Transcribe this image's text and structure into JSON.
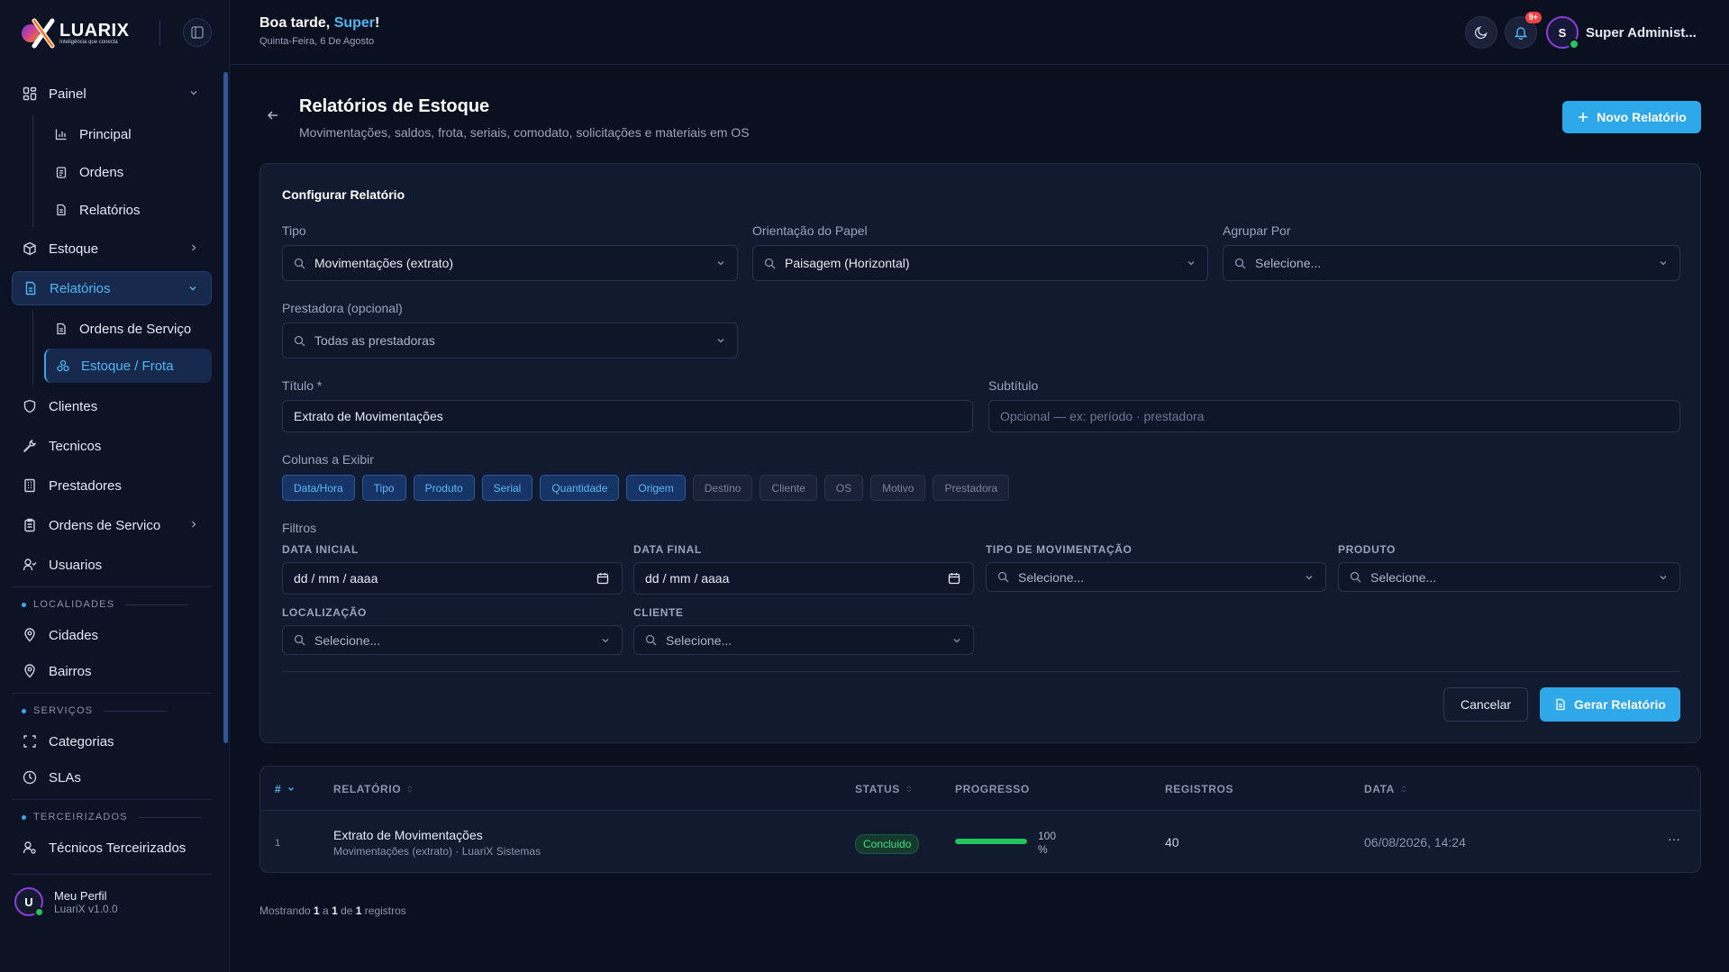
{
  "brand": {
    "name": "LUARIX",
    "tagline": "Inteligência que conecta"
  },
  "sidebar": {
    "painel": {
      "label": "Painel",
      "sub": [
        "Principal",
        "Ordens",
        "Relatórios"
      ]
    },
    "estoque": "Estoque",
    "relatorios": {
      "label": "Relatórios",
      "sub": [
        "Ordens de Serviço",
        "Estoque / Frota"
      ]
    },
    "clientes": "Clientes",
    "tecnicos": "Tecnicos",
    "prestadores": "Prestadores",
    "ordens_servico": "Ordens de Servico",
    "usuarios": "Usuarios",
    "sec_localidades": "LOCALIDADES",
    "cidades": "Cidades",
    "bairros": "Bairros",
    "sec_servicos": "SERVIÇOS",
    "categorias": "Categorias",
    "slas": "SLAs",
    "sec_terceirizados": "TERCEIRIZADOS",
    "tecnicos_terceirizados": "Técnicos Terceirizados",
    "profile": {
      "initial": "U",
      "name": "Meu Perfil",
      "version": "LuariX v1.0.0"
    }
  },
  "header": {
    "greet_prefix": "Boa tarde, ",
    "greet_name": "Super",
    "greet_suffix": "!",
    "date": "Quinta-Feira, 6 De Agosto",
    "notif_badge": "9+",
    "user_initial": "S",
    "user_name": "Super Administ..."
  },
  "page": {
    "title": "Relatórios de Estoque",
    "subtitle": "Movimentações, saldos, frota, seriais, comodato, solicitações e materiais em OS",
    "new_button": "Novo Relatório"
  },
  "config": {
    "title": "Configurar Relatório",
    "tipo": {
      "label": "Tipo",
      "value": "Movimentações (extrato)"
    },
    "orientacao": {
      "label": "Orientação do Papel",
      "value": "Paisagem (Horizontal)"
    },
    "agrupar": {
      "label": "Agrupar Por",
      "placeholder": "Selecione..."
    },
    "prestadora": {
      "label": "Prestadora (opcional)",
      "value": "Todas as prestadoras"
    },
    "titulo": {
      "label": "Título *",
      "value": "Extrato de Movimentações"
    },
    "subtitulo": {
      "label": "Subtítulo",
      "placeholder": "Opcional — ex: período · prestadora"
    },
    "colunas_label": "Colunas a Exibir",
    "colunas": [
      {
        "label": "Data/Hora",
        "on": true
      },
      {
        "label": "Tipo",
        "on": true
      },
      {
        "label": "Produto",
        "on": true
      },
      {
        "label": "Serial",
        "on": true
      },
      {
        "label": "Quantidade",
        "on": true
      },
      {
        "label": "Origem",
        "on": true
      },
      {
        "label": "Destino",
        "on": false
      },
      {
        "label": "Cliente",
        "on": false
      },
      {
        "label": "OS",
        "on": false
      },
      {
        "label": "Motivo",
        "on": false
      },
      {
        "label": "Prestadora",
        "on": false
      }
    ],
    "filtros_label": "Filtros",
    "data_inicial": {
      "label": "DATA INICIAL",
      "placeholder": "dd / mm / aaaa"
    },
    "data_final": {
      "label": "DATA FINAL",
      "placeholder": "dd / mm / aaaa"
    },
    "tipo_mov": {
      "label": "TIPO DE MOVIMENTAÇÃO",
      "placeholder": "Selecione..."
    },
    "produto": {
      "label": "PRODUTO",
      "placeholder": "Selecione..."
    },
    "localizacao": {
      "label": "LOCALIZAÇÃO",
      "placeholder": "Selecione..."
    },
    "cliente": {
      "label": "CLIENTE",
      "placeholder": "Selecione..."
    },
    "cancel": "Cancelar",
    "generate": "Gerar Relatório"
  },
  "table": {
    "headers": {
      "num": "#",
      "relatorio": "RELATÓRIO",
      "status": "STATUS",
      "progresso": "PROGRESSO",
      "registros": "REGISTROS",
      "data": "DATA"
    },
    "rows": [
      {
        "num": "1",
        "title": "Extrato de Movimentações",
        "meta": "Movimentações (extrato) · LuariX Sistemas",
        "status": "Concluido",
        "progress": 100,
        "progress_label": "100 %",
        "registros": "40",
        "data": "06/08/2026, 14:24",
        "menu": "···"
      }
    ]
  },
  "footer": {
    "prefix": "Mostrando ",
    "from": "1",
    "mid1": " a ",
    "to": "1",
    "mid2": " de ",
    "total": "1",
    "suffix": " registros"
  }
}
